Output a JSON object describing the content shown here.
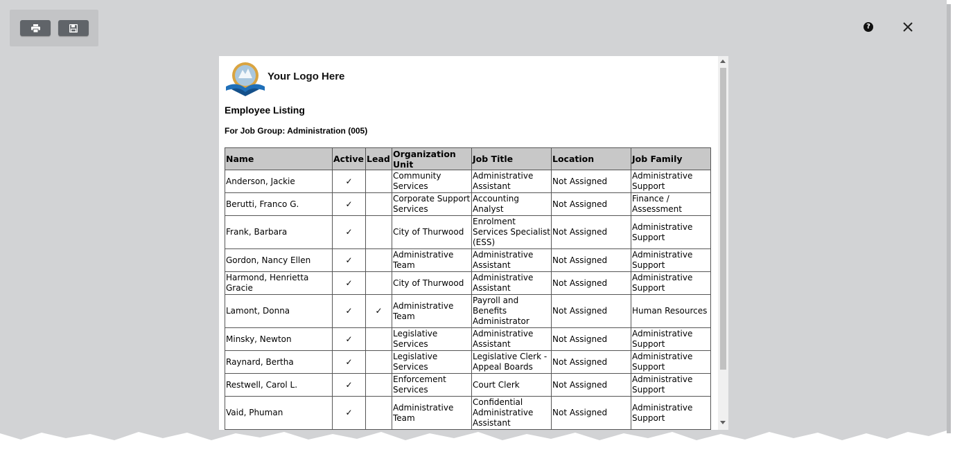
{
  "toolbar": {
    "print_icon": "printer-icon",
    "save_icon": "floppy-disk-icon"
  },
  "header_controls": {
    "help_icon": "question-circle-icon",
    "help_glyph": "?",
    "close_icon": "close-icon"
  },
  "report": {
    "logo_text": "Your Logo Here",
    "title": "Employee Listing",
    "subtitle": "For Job Group: Administration (005)",
    "columns": [
      "Name",
      "Active",
      "Lead",
      "Organization Unit",
      "Job Title",
      "Location",
      "Job Family"
    ],
    "rows": [
      {
        "name": "Anderson, Jackie",
        "active": "✓",
        "lead": "",
        "org_unit": "Community Services",
        "job_title": "Administrative Assistant",
        "location": "Not Assigned",
        "job_family": "Administrative Support"
      },
      {
        "name": "Berutti, Franco G.",
        "active": "✓",
        "lead": "",
        "org_unit": "Corporate Support Services",
        "job_title": "Accounting Analyst",
        "location": "Not Assigned",
        "job_family": "Finance / Assessment"
      },
      {
        "name": "Frank, Barbara",
        "active": "✓",
        "lead": "",
        "org_unit": "City of Thurwood",
        "job_title": "Enrolment Services Specialist (ESS)",
        "location": "Not Assigned",
        "job_family": "Administrative Support"
      },
      {
        "name": "Gordon, Nancy Ellen",
        "active": "✓",
        "lead": "",
        "org_unit": "Administrative Team",
        "job_title": "Administrative Assistant",
        "location": "Not Assigned",
        "job_family": "Administrative Support"
      },
      {
        "name": "Harmond, Henrietta Gracie",
        "active": "✓",
        "lead": "",
        "org_unit": "City of Thurwood",
        "job_title": "Administrative Assistant",
        "location": "Not Assigned",
        "job_family": "Administrative Support"
      },
      {
        "name": "Lamont, Donna",
        "active": "✓",
        "lead": "✓",
        "org_unit": "Administrative Team",
        "job_title": "Payroll and Benefits Administrator",
        "location": "Not Assigned",
        "job_family": "Human Resources"
      },
      {
        "name": "Minsky, Newton",
        "active": "✓",
        "lead": "",
        "org_unit": "Legislative Services",
        "job_title": "Administrative Assistant",
        "location": "Not Assigned",
        "job_family": "Administrative Support"
      },
      {
        "name": "Raynard, Bertha",
        "active": "✓",
        "lead": "",
        "org_unit": "Legislative Services",
        "job_title": "Legislative Clerk - Appeal Boards",
        "location": "Not Assigned",
        "job_family": "Administrative Support"
      },
      {
        "name": "Restwell, Carol L.",
        "active": "✓",
        "lead": "",
        "org_unit": "Enforcement Services",
        "job_title": "Court Clerk",
        "location": "Not Assigned",
        "job_family": "Administrative Support"
      },
      {
        "name": "Vaid, Phuman",
        "active": "✓",
        "lead": "",
        "org_unit": "Administrative Team",
        "job_title": "Confidential Administrative Assistant",
        "location": "Not Assigned",
        "job_family": "Administrative Support"
      }
    ]
  },
  "colors": {
    "overlay": "#d2d3d5",
    "button": "#606469",
    "header_row": "#c8c8c8"
  }
}
